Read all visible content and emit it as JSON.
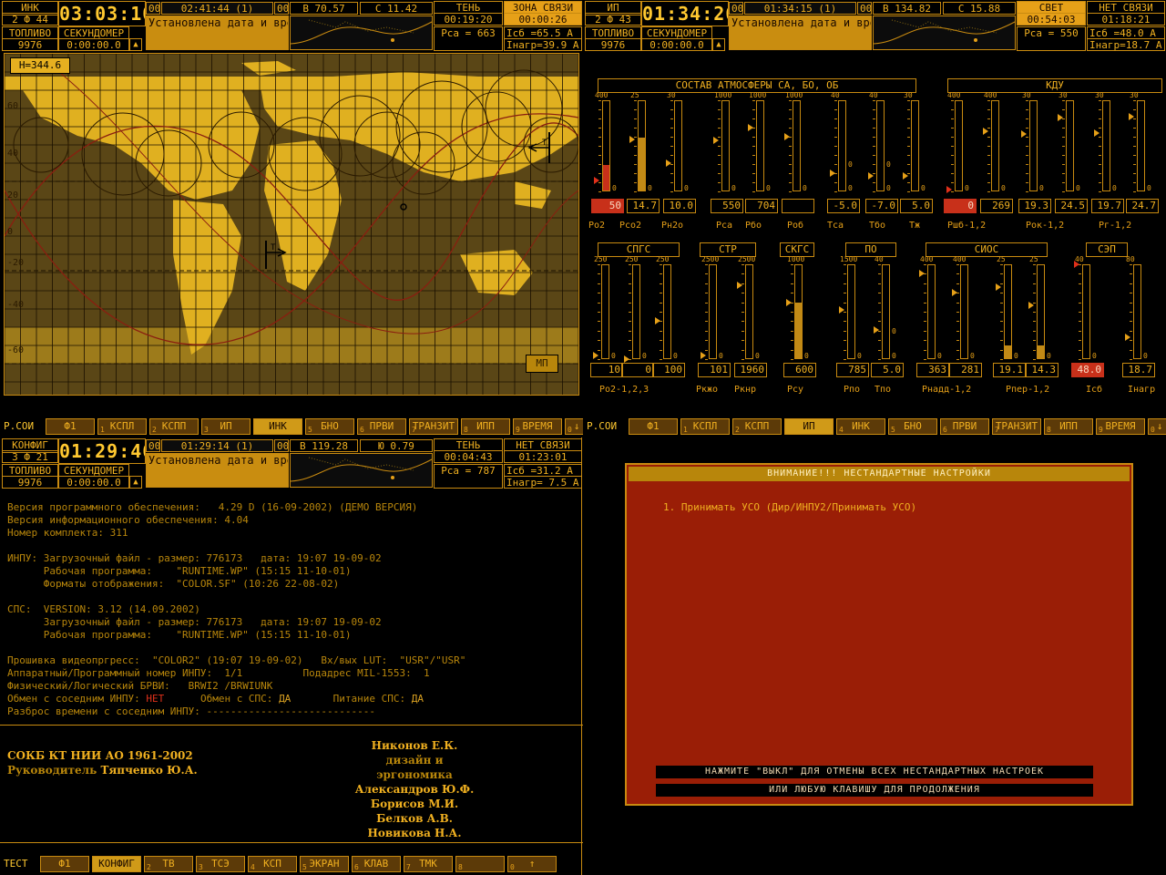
{
  "panels": [
    {
      "header": {
        "mode": "ИНК",
        "mode_sub": "2 Ф 44",
        "clock": "03:03:10",
        "sub_clock": "02:41:44 (1)",
        "box_a": "00",
        "box_b": "00",
        "message": "Установлена дата и время от КС-020",
        "fuel_label": "ТОПЛИВО",
        "fuel": "9976",
        "stopwatch_label": "СЕКУНДОМЕР",
        "stopwatch": "0:00:00.0",
        "lon": "В  70.57",
        "lat": "С 11.42",
        "light_label": "ТЕНЬ",
        "light_time": "00:19:20",
        "comm_label": "ЗОНА СВЯЗИ",
        "comm_time": "00:00:26",
        "p1": "Рса = 663",
        "p2": "Iсб  =65.5 А",
        "p3": "Iнагр=39.9 А"
      },
      "toolbar": {
        "label": "Р.СОИ",
        "keys": [
          {
            "n": "",
            "t": "Ф1"
          },
          {
            "n": "1",
            "t": "КСПЛ"
          },
          {
            "n": "2",
            "t": "КСПП"
          },
          {
            "n": "3",
            "t": "ИП"
          },
          {
            "n": "",
            "t": "ИНК"
          },
          {
            "n": "5",
            "t": "БНО"
          },
          {
            "n": "6",
            "t": "ПРВИ"
          },
          {
            "n": "7",
            "t": "ТРАНЗИТ"
          },
          {
            "n": "8",
            "t": "ИПП"
          },
          {
            "n": "9",
            "t": "ВРЕМЯ"
          },
          {
            "n": "0",
            "t": "↓"
          }
        ]
      }
    },
    {
      "header": {
        "mode": "ИП",
        "mode_sub": "2 Ф 43",
        "clock": "01:34:26",
        "sub_clock": "01:34:15 (1)",
        "box_a": "00",
        "box_b": "00",
        "message": "Установлена дата и время от КС-020",
        "fuel_label": "ТОПЛИВО",
        "fuel": "9976",
        "stopwatch_label": "СЕКУНДОМЕР",
        "stopwatch": "0:00:00.0",
        "lon": "В 134.82",
        "lat": "С 15.88",
        "light_label": "СВЕТ",
        "light_time": "00:54:03",
        "comm_label": "НЕТ СВЯЗИ",
        "comm_time": "01:18:21",
        "p1": "Рса = 550",
        "p2": "Iсб  =48.0 А",
        "p3": "Iнагр=18.7 А"
      },
      "toolbar": {
        "label": "Р.СОИ",
        "keys": [
          {
            "n": "",
            "t": "Ф1"
          },
          {
            "n": "1",
            "t": "КСПЛ"
          },
          {
            "n": "2",
            "t": "КСПП"
          },
          {
            "n": "",
            "t": "ИП"
          },
          {
            "n": "4",
            "t": "ИНК"
          },
          {
            "n": "5",
            "t": "БНО"
          },
          {
            "n": "6",
            "t": "ПРВИ"
          },
          {
            "n": "7",
            "t": "ТРАНЗИТ"
          },
          {
            "n": "8",
            "t": "ИПП"
          },
          {
            "n": "9",
            "t": "ВРЕМЯ"
          },
          {
            "n": "0",
            "t": "↓"
          }
        ]
      }
    },
    {
      "header": {
        "mode": "КОНФИГ",
        "mode_sub": "3 Ф 21",
        "clock": "01:29:46",
        "sub_clock": "01:29:14 (1)",
        "box_a": "00",
        "box_b": "00",
        "message": "Установлена дата и время от КС-020",
        "fuel_label": "ТОПЛИВО",
        "fuel": "9976",
        "stopwatch_label": "СЕКУНДОМЕР",
        "stopwatch": "0:00:00.0",
        "lon": "В 119.28",
        "lat": "Ю  0.79",
        "light_label": "ТЕНЬ",
        "light_time": "00:04:43",
        "comm_label": "НЕТ СВЯЗИ",
        "comm_time": "01:23:01",
        "p1": "Рса = 787",
        "p2": "Iсб  =31.2 А",
        "p3": "Iнагр= 7.5 А"
      },
      "toolbar": {
        "label": "ТЕСТ",
        "keys": [
          {
            "n": "",
            "t": "Ф1"
          },
          {
            "n": "",
            "t": "КОНФИГ"
          },
          {
            "n": "2",
            "t": "ТВ"
          },
          {
            "n": "3",
            "t": "ТСЭ"
          },
          {
            "n": "4",
            "t": "КСП"
          },
          {
            "n": "5",
            "t": "ЭКРАН"
          },
          {
            "n": "6",
            "t": "КЛАВ"
          },
          {
            "n": "7",
            "t": "ТМК"
          },
          {
            "n": "8",
            "t": ""
          },
          {
            "n": "0",
            "t": "↑"
          }
        ]
      }
    }
  ],
  "map": {
    "altitude": "Н=344.6",
    "lat_labels": [
      "60",
      "40",
      "20",
      "0",
      "-20",
      "-40",
      "-60"
    ],
    "mp_button": "МП",
    "marker1": "Т",
    "marker2": "Т"
  },
  "gauges": {
    "sections": [
      {
        "id": "atm",
        "title": "СОСТАВ  АТМОСФЕРЫ СА, БО, ОБ"
      },
      {
        "id": "kdu",
        "title": "КДУ"
      },
      {
        "id": "spgs",
        "title": "СПГС"
      },
      {
        "id": "str",
        "title": "СТР"
      },
      {
        "id": "skgs",
        "title": "СКГС"
      },
      {
        "id": "po",
        "title": "ПО"
      },
      {
        "id": "sios",
        "title": "СИОС"
      },
      {
        "id": "sep",
        "title": "СЭП"
      }
    ],
    "row1": [
      {
        "max": "400",
        "v": "50",
        "level": 0.29,
        "mark": 0.12,
        "red": true
      },
      {
        "max": "25",
        "v": "14.7",
        "level": 0.59,
        "mark": 0.57
      },
      {
        "max": "30",
        "v": "10.0",
        "level": 0.0,
        "mark": 0.31
      },
      {
        "max": "1000",
        "v": "550",
        "level": 0.0,
        "mark": 0.56
      },
      {
        "max": "1000",
        "v": "704",
        "level": 0.0,
        "mark": 0.7
      },
      {
        "max": "1000",
        "v": "",
        "level": 0.0,
        "mark": 0.6
      },
      {
        "max": "40",
        "v": "-5.0",
        "level": 0.0,
        "mark": 0.2,
        "mid": "0"
      },
      {
        "max": "40",
        "v": "-7.0",
        "level": 0.0,
        "mark": 0.17,
        "mid": "0"
      },
      {
        "max": "30",
        "v": "5.0",
        "level": 0.0,
        "mark": 0.17
      },
      {
        "max": "400",
        "v": "0",
        "level": 0.0,
        "mark": 0.02,
        "red": true
      },
      {
        "max": "400",
        "v": "269",
        "level": 0.0,
        "mark": 0.66
      },
      {
        "max": "30",
        "v": "19.3",
        "level": 0.0,
        "mark": 0.63
      },
      {
        "max": "30",
        "v": "24.5",
        "level": 0.0,
        "mark": 0.81
      },
      {
        "max": "30",
        "v": "19.7",
        "level": 0.0,
        "mark": 0.64
      },
      {
        "max": "30",
        "v": "24.7",
        "level": 0.0,
        "mark": 0.82
      }
    ],
    "row1_labels": [
      "Ро2",
      "Рсо2",
      "Рн2о",
      "Рса",
      "Рбо",
      "Роб",
      "Тса",
      "Тбо",
      "Тж",
      "Ршб-1,2",
      "Рок-1,2",
      "Рг-1,2"
    ],
    "row2": [
      {
        "max": "250",
        "v": "10",
        "level": 0.0,
        "mark": 0.04
      },
      {
        "max": "250",
        "v": "0",
        "level": 0.0,
        "mark": 0.0
      },
      {
        "max": "250",
        "v": "100",
        "level": 0.0,
        "mark": 0.4
      },
      {
        "max": "2500",
        "v": "101",
        "level": 0.0,
        "mark": 0.04
      },
      {
        "max": "2500",
        "v": "1960",
        "level": 0.0,
        "mark": 0.78
      },
      {
        "max": "1000",
        "v": "600",
        "level": 0.6,
        "mark": 0.6
      },
      {
        "max": "1500",
        "v": "785",
        "level": 0.0,
        "mark": 0.52
      },
      {
        "max": "40",
        "v": "5.0",
        "level": 0.0,
        "mark": 0.31,
        "mid": "0"
      },
      {
        "max": "400",
        "v": "363",
        "level": 0.0,
        "mark": 0.9
      },
      {
        "max": "400",
        "v": "281",
        "level": 0.0,
        "mark": 0.7
      },
      {
        "max": "25",
        "v": "19.1",
        "level": 0.14,
        "mark": 0.76
      },
      {
        "max": "25",
        "v": "14.3",
        "level": 0.14,
        "mark": 0.57
      },
      {
        "max": "40",
        "v": "48.0",
        "level": 0.0,
        "mark": 1.0,
        "red": true
      },
      {
        "max": "80",
        "v": "18.7",
        "level": 0.0,
        "mark": 0.23
      }
    ],
    "row2_labels": [
      "Ро2-1,2,3",
      "Ркжо",
      "Ркнр",
      "Рсу",
      "Рпо",
      "Тпо",
      "Рнадд-1,2",
      "Рпер-1,2",
      "Iсб",
      "Iнагр"
    ],
    "zero": "0"
  },
  "config": {
    "lines": [
      "Версия программного обеспечения:   4.29 D (16-09-2002) (ДЕМО ВЕРСИЯ)",
      "Версия информационного обеспечения: 4.04",
      "Номер комплекта: 311",
      "",
      "ИНПУ: Загрузочный файл - размер: 776173   дата: 19:07 19-09-02",
      "      Рабочая программа:    \"RUNTIME.WP\" (15:15 11-10-01)",
      "      Форматы отображения:  \"COLOR.SF\" (10:26 22-08-02)",
      "",
      "СПС:  VERSION: 3.12 (14.09.2002)",
      "      Загрузочный файл - размер: 776173   дата: 19:07 19-09-02",
      "      Рабочая программа:    \"RUNTIME.WP\" (15:15 11-10-01)",
      "",
      "Прошивка видеопргресс:  \"COLOR2\" (19:07 19-09-02)   Вх/вых LUT:  \"USR\"/\"USR\"",
      "Аппаратный/Программный номер ИНПУ:  1/1          Подадрес MIL-1553:  1",
      "Физический/Логический БРВИ:   BRWI2 /BRWIUNK"
    ],
    "exchange_label": "Обмен с соседним ИНПУ:",
    "exchange_value": "НЕТ",
    "sps_exchange_label": "Обмен с СПС:",
    "sps_exchange_value": "ДА",
    "power_label": "Питание СПС:",
    "power_value": "ДА",
    "spread_label": "Разброс времени с соседним ИНПУ:",
    "spread_value": "----------------------------",
    "org": "СОКБ КТ НИИ АО 1961-2002",
    "head_label": "Руководитель",
    "head_name": "Тяпченко Ю.А.",
    "credits": [
      "Никонов Е.К.",
      "дизайн и эргономика",
      "Александров Ю.Ф.",
      "Борисов М.И.",
      "Белков А.В.",
      "Новикова Н.А."
    ]
  },
  "dialog": {
    "title": "ВНИМАНИЕ!!! НЕСТАНДАРТНЫЕ НАСТРОЙКИ",
    "item": "1. Принимать УСО (Дир/ИНПУ2/Принимать УСО)",
    "hint1": "НАЖМИТЕ \"ВЫКЛ\" ДЛЯ ОТМЕНЫ ВСЕХ НЕСТАНДАРТНЫХ НАСТРОЕК",
    "hint2": "ИЛИ ЛЮБУЮ КЛАВИШУ ДЛЯ ПРОДОЛЖЕНИЯ"
  }
}
